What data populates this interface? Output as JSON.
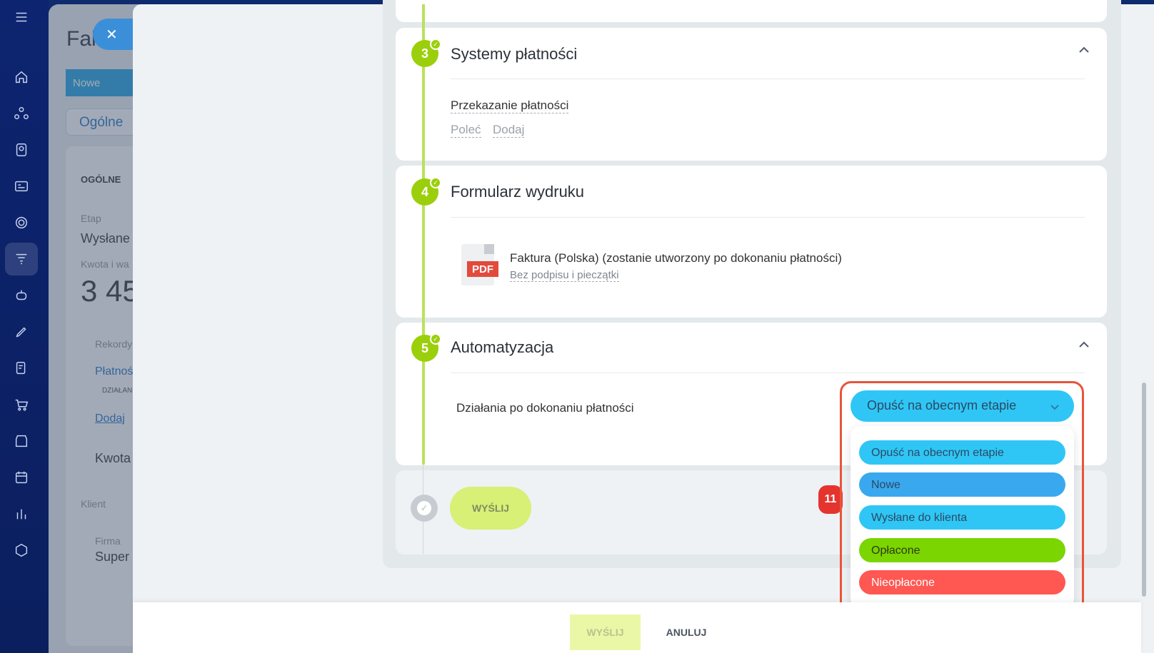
{
  "background": {
    "page_title": "Fak",
    "stage_button": "Nowe",
    "tab_general": "Ogólne",
    "section_general": "OGÓLNE",
    "stage_label": "Etap",
    "stage_value": "Wysłane",
    "amount_label": "Kwota i wa",
    "amount_value": "3 45",
    "records_label": "Rekordy",
    "payments_link": "Płatnoś",
    "actions_tag": "DZIAŁAN",
    "add_link": "Dodaj",
    "amount_label2": "Kwota",
    "client_label": "Klient",
    "company_label": "Firma",
    "company_value": "Super"
  },
  "steps": [
    {
      "num": "3",
      "title": "Systemy płatności",
      "field_label": "Przekazanie płatności",
      "links": [
        "Poleć",
        "Dodaj"
      ]
    },
    {
      "num": "4",
      "title": "Formularz wydruku",
      "doc_title": "Faktura (Polska) (zostanie utworzony po dokonaniu płatności)",
      "doc_sub": "Bez podpisu i pieczątki",
      "file_tag": "PDF"
    },
    {
      "num": "5",
      "title": "Automatyzacja",
      "field_label": "Działania po dokonaniu płatności"
    }
  ],
  "send_step_button": "WYŚLIJ",
  "badge": "11",
  "dropdown": {
    "selected": "Opuść na obecnym etapie",
    "options": [
      {
        "label": "Opuść na obecnym etapie",
        "color": "#2fc6f6",
        "text_color": "#2b4a63"
      },
      {
        "label": "Nowe",
        "color": "#39a8ef",
        "text_color": "#2b4a63"
      },
      {
        "label": "Wysłane do klienta",
        "color": "#2fc6f6",
        "text_color": "#2b4a63"
      },
      {
        "label": "Opłacone",
        "color": "#7bd500",
        "text_color": "#2b3c10"
      },
      {
        "label": "Nieopłacone",
        "color": "#ff5752",
        "text_color": "#ffffff"
      }
    ]
  },
  "footer": {
    "send": "WYŚLIJ",
    "cancel": "ANULUJ"
  },
  "colors": {
    "accent_green": "#9bcf0b",
    "highlight_frame": "#e8553a",
    "badge_red": "#e5342e"
  }
}
